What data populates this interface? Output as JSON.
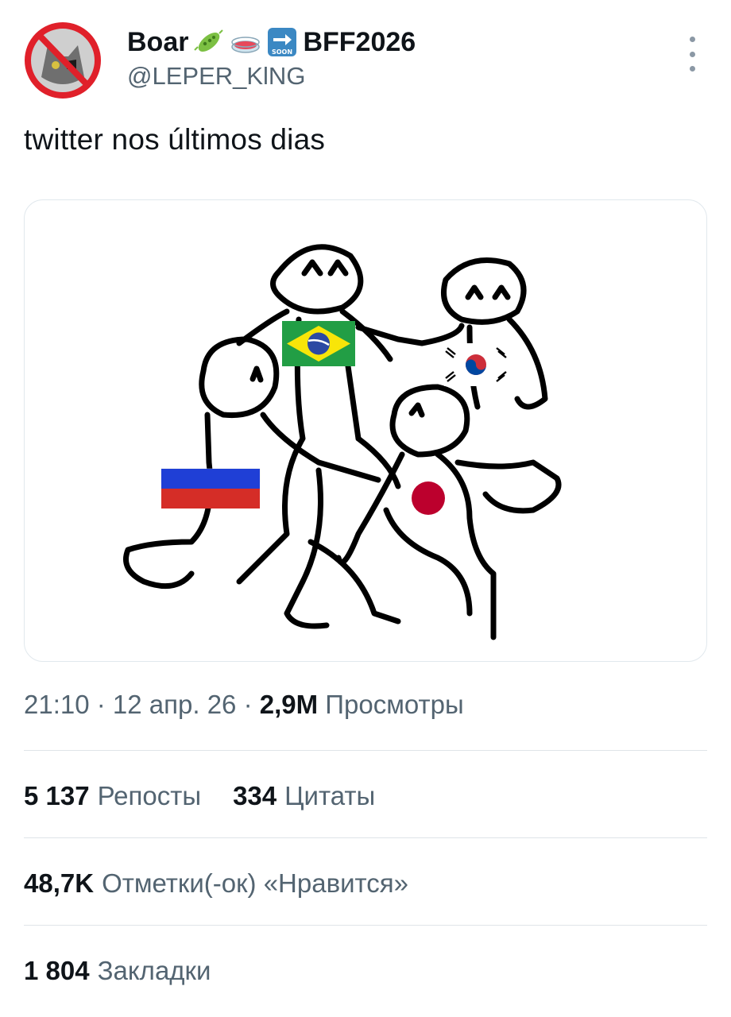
{
  "author": {
    "display_name": "Boar",
    "name_suffix": "BFF2026",
    "handle": "@LEPER_KlNG",
    "emojis": [
      "microbe-icon",
      "petri-dish-icon",
      "soon-arrow-icon"
    ]
  },
  "tweet": {
    "text": "twitter nos últimos dias",
    "media_flags": [
      "brazil-flag",
      "south-korea-flag",
      "russia-flag",
      "japan-flag"
    ]
  },
  "meta": {
    "time": "21:10",
    "date": "12 апр. 26",
    "views_count": "2,9M",
    "views_label": "Просмотры"
  },
  "stats": {
    "reposts_count": "5 137",
    "reposts_label": "Репосты",
    "quotes_count": "334",
    "quotes_label": "Цитаты",
    "likes_count": "48,7K",
    "likes_label": "Отметки(-ок) «Нравится»",
    "bookmarks_count": "1 804",
    "bookmarks_label": "Закладки"
  },
  "colors": {
    "text_primary": "#0f1419",
    "text_secondary": "#536471",
    "divider": "#dfe4e8"
  }
}
